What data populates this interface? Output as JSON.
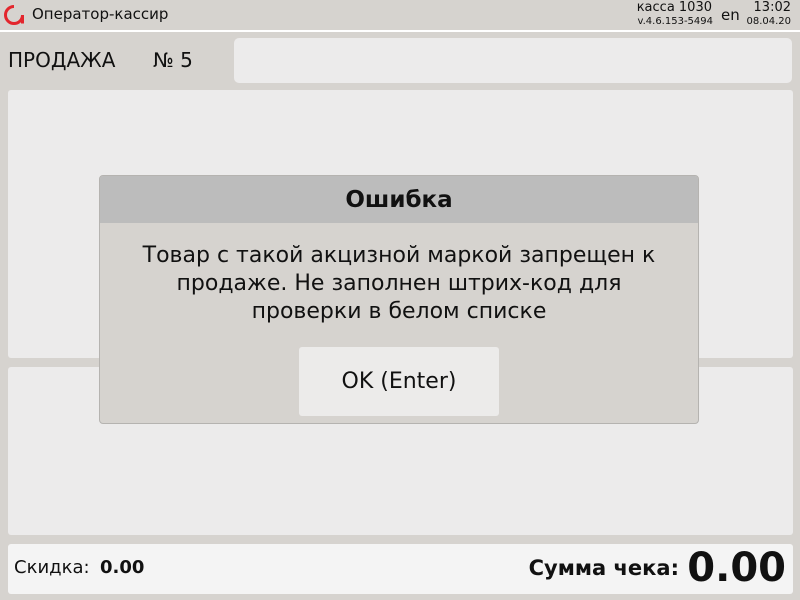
{
  "header": {
    "app_title": "Оператор-кассир",
    "register": "касса 1030",
    "version": "v.4.6.153-5494",
    "language": "en",
    "time": "13:02",
    "date": "08.04.20",
    "brand_color": "#e3262d",
    "logo_icon": "atol-logo-icon"
  },
  "sale": {
    "label": "ПРОДАЖА",
    "number": "№ 5",
    "search_value": ""
  },
  "dialog": {
    "title": "Ошибка",
    "message": "Товар с такой акцизной маркой запрещен к продаже. Не заполнен штрих-код для проверки в белом списке",
    "ok_label": "OK (Enter)"
  },
  "footer": {
    "discount_label": "Скидка:",
    "discount_value": "0.00",
    "total_label": "Сумма чека:",
    "total_value": "0.00"
  }
}
